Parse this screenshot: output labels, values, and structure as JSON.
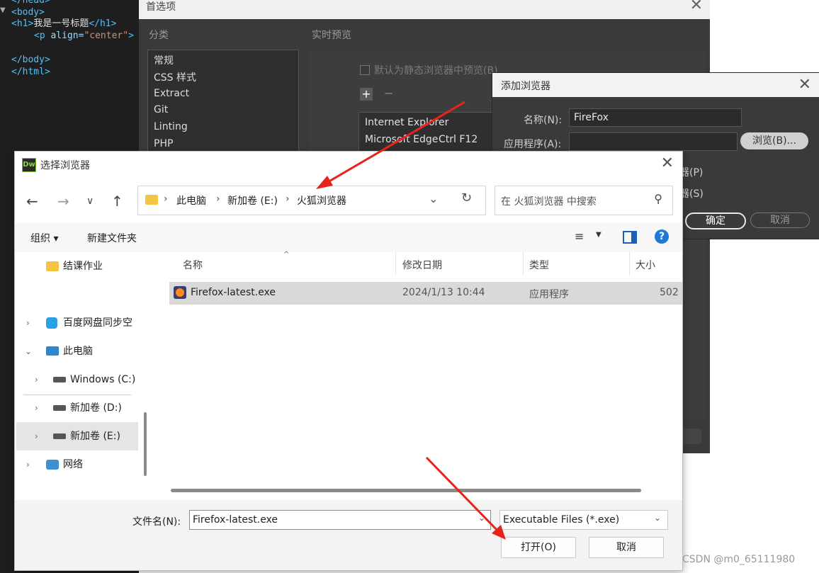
{
  "editor": {
    "lines": [
      "</head>",
      "<body>",
      "<h1>我是一号标题</h1>",
      "<p align=\"center\">",
      "",
      "</body>",
      "</html>"
    ],
    "h1_open": "<h1>",
    "h1_text": "我是一号标题",
    "h1_close": "</h1>",
    "p_tag_open": "<p ",
    "p_attr": "align=",
    "p_value": "\"center\"",
    "p_close": ">",
    "body_open": "<body>",
    "body_close": "</body>",
    "html_close": "</html>",
    "head_close": "</head>"
  },
  "prefs": {
    "title": "首选项",
    "category_label": "分类",
    "preview_label": "实时预览",
    "categories": [
      "常规",
      "CSS 样式",
      "Extract",
      "Git",
      "Linting",
      "PHP"
    ],
    "static_preview_label": "默认为静态浏览器中预览(B)",
    "browsers": [
      {
        "name": "Internet Explorer",
        "shortcut": ""
      },
      {
        "name": "Microsoft Edge",
        "shortcut": "Ctrl F12"
      }
    ]
  },
  "add_browser": {
    "title": "添加浏览器",
    "name_label": "名称(N):",
    "name_value": "FireFox",
    "app_label": "应用程序(A):",
    "app_value": "",
    "browse_button": "浏览(B)...",
    "primary_label": "器(P)",
    "secondary_label": "器(S)",
    "ok_button": "确定",
    "cancel_button": "取消"
  },
  "file_dialog": {
    "title": "选择浏览器",
    "app_icon_text": "Dw",
    "breadcrumbs": [
      "此电脑",
      "新加卷 (E:)",
      "火狐浏览器"
    ],
    "search_placeholder": "在 火狐浏览器 中搜索",
    "toolbar": {
      "organize": "组织 ▾",
      "new_folder": "新建文件夹"
    },
    "sidebar": [
      {
        "label": "结课作业",
        "icon": "folder-icon"
      },
      {
        "label": "百度网盘同步空",
        "icon": "cloud-icon"
      },
      {
        "label": "此电脑",
        "icon": "pc-icon"
      },
      {
        "label": "Windows (C:)",
        "icon": "drive-icon"
      },
      {
        "label": "新加卷 (D:)",
        "icon": "drive-icon"
      },
      {
        "label": "新加卷 (E:)",
        "icon": "drive-icon"
      },
      {
        "label": "网络",
        "icon": "network-icon"
      }
    ],
    "columns": [
      "名称",
      "修改日期",
      "类型",
      "大小"
    ],
    "files": [
      {
        "name": "Firefox-latest.exe",
        "modified": "2024/1/13 10:44",
        "type": "应用程序",
        "size": "502"
      }
    ],
    "filename_label": "文件名(N):",
    "filename_value": "Firefox-latest.exe",
    "filetype_value": "Executable Files (*.exe)",
    "open_button": "打开(O)",
    "cancel_button": "取消"
  },
  "watermark": "CSDN @m0_65111980",
  "colors": {
    "annotation_arrow": "#e8231c",
    "accent": "#1e78d7"
  }
}
